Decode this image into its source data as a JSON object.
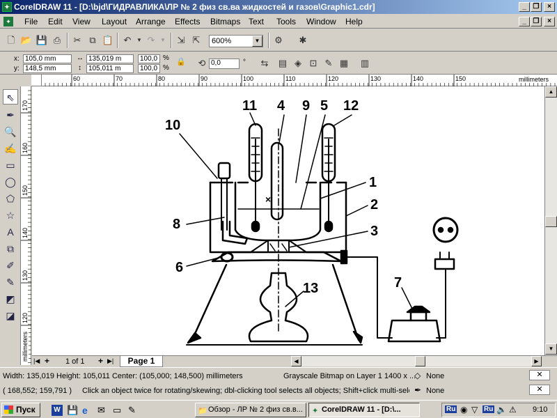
{
  "window": {
    "title": "CorelDRAW 11 - [D:\\bjd\\ГИДРАВЛИКА\\ЛР № 2 физ св.ва жидкостей и газов\\Graphic1.cdr]",
    "controls": [
      "_",
      "❐",
      "×"
    ]
  },
  "menu": [
    "File",
    "Edit",
    "View",
    "Layout",
    "Arrange",
    "Effects",
    "Bitmaps",
    "Text",
    "Tools",
    "Window",
    "Help"
  ],
  "toolbar": {
    "zoom": "600%"
  },
  "property_bar": {
    "x_label": "x:",
    "x": "105,0 mm",
    "y_label": "y:",
    "y": "148,5 mm",
    "width": "135,019 m",
    "height": "105,011 m",
    "scale_x": "100,0",
    "scale_y": "100,0",
    "percent": "%",
    "angle": "0,0",
    "degree": "°"
  },
  "rulers": {
    "units": "millimeters",
    "h_ticks": [
      "60",
      "70",
      "80",
      "90",
      "100",
      "110",
      "120",
      "130",
      "140",
      "150"
    ],
    "v_ticks": [
      "170",
      "160",
      "150",
      "140",
      "130",
      "120"
    ]
  },
  "page_nav": {
    "counter": "1 of 1",
    "tab": "Page 1"
  },
  "diagram": {
    "labels": [
      "11",
      "4",
      "9",
      "5",
      "12",
      "10",
      "1",
      "2",
      "8",
      "3",
      "6",
      "7",
      "13"
    ]
  },
  "status": {
    "dims": "Width: 135,019  Height: 105,011  Center: (105,000; 148,500)  millimeters",
    "object": "Grayscale Bitmap on Layer 1 1400 x ...",
    "fill": "None",
    "coords": "( 168,552; 159,791 )",
    "hint": "Click an object twice for rotating/skewing; dbl-clicking tool selects all objects; Shift+click multi-sele...",
    "outline": "None"
  },
  "taskbar": {
    "start": "Пуск",
    "tasks": [
      "Обзор - ЛР № 2 физ св.в...",
      "CorelDRAW 11 - [D:\\..."
    ],
    "clock": "9:10"
  },
  "colors": {
    "title_start": "#0a246a",
    "title_end": "#a6caf0",
    "face": "#d4d0c8",
    "canvas": "#ffffff"
  }
}
